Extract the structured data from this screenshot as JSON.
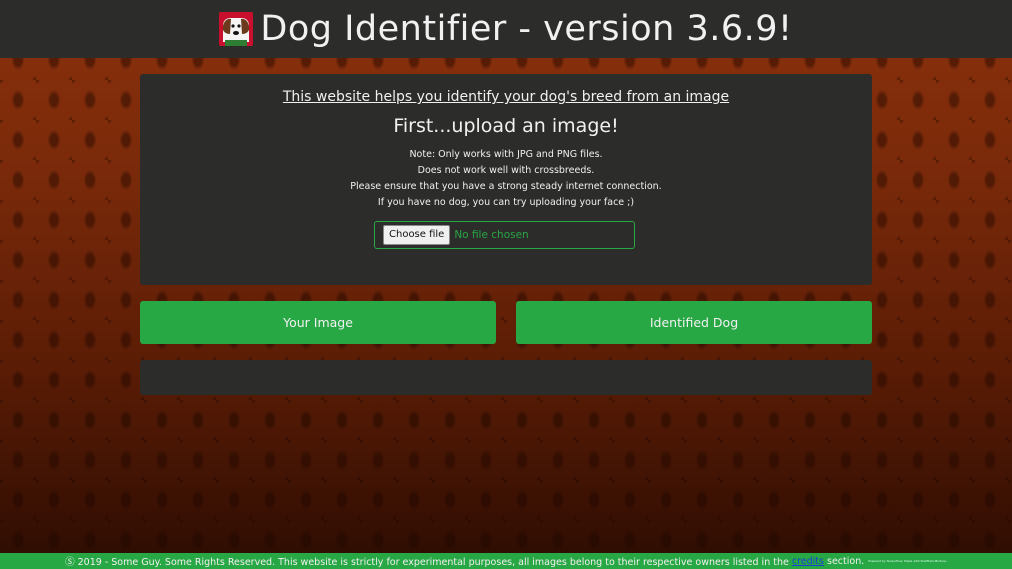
{
  "header": {
    "title": "Dog Identifier - version 3.6.9!",
    "logo_icon": "dog-icon"
  },
  "panel": {
    "tagline": "This website helps you identify your dog's breed from an image",
    "heading": "First...upload an image!",
    "notes": [
      "Note: Only works with JPG and PNG files.",
      "Does not work well with crossbreeds.",
      "Please ensure that you have a strong steady internet connection.",
      "If you have no dog, you can try uploading your face ;)"
    ],
    "upload": {
      "button_label": "Choose file",
      "status": "No file chosen"
    }
  },
  "buttons": {
    "your_image": "Your Image",
    "identified_dog": "Identified Dog"
  },
  "footer": {
    "text_before": "Ⓢ 2019 - Some Guy. Some Rights Reserved. This website is strictly for experimental purposes, all images belong to their respective owners listed in the",
    "link": "credits",
    "text_after": "section.",
    "fine_print": "Powered by Tensorflow. Made with Sheffield Mixture."
  },
  "colors": {
    "accent": "#28a745",
    "panel": "#2c2c2a",
    "background": "#6a2108",
    "link": "#1a3fd1"
  }
}
